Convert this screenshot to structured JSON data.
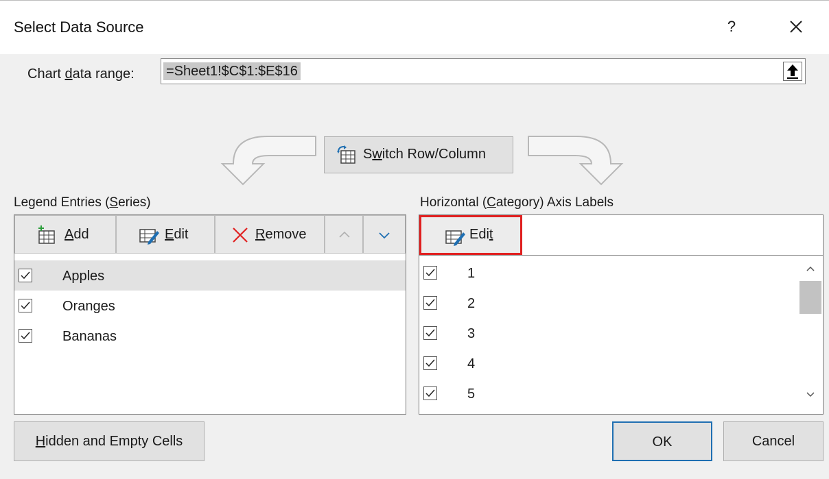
{
  "dialog": {
    "title": "Select Data Source",
    "help": "?",
    "close_icon": "close-icon"
  },
  "range": {
    "label_pre": "Chart ",
    "label_u": "d",
    "label_post": "ata range:",
    "value": "=Sheet1!$C$1:$E$16"
  },
  "switch": {
    "pre": "S",
    "u": "w",
    "post": "itch Row/Column"
  },
  "legend": {
    "label_pre": "Legend Entries (",
    "label_u": "S",
    "label_post": "eries)",
    "add_u": "A",
    "add_post": "dd",
    "edit_u": "E",
    "edit_post": "dit",
    "remove_u": "R",
    "remove_post": "emove",
    "items": [
      "Apples",
      "Oranges",
      "Bananas"
    ]
  },
  "axis": {
    "label_pre": "Horizontal (",
    "label_u": "C",
    "label_post": "ategory) Axis Labels",
    "edit_pre": "Edi",
    "edit_u": "t",
    "items": [
      "1",
      "2",
      "3",
      "4",
      "5"
    ]
  },
  "footer": {
    "hidden_u": "H",
    "hidden_post": "idden and Empty Cells",
    "ok": "OK",
    "cancel": "Cancel"
  },
  "colors": {
    "highlight": "#e02020",
    "accent": "#1f6fb2"
  }
}
